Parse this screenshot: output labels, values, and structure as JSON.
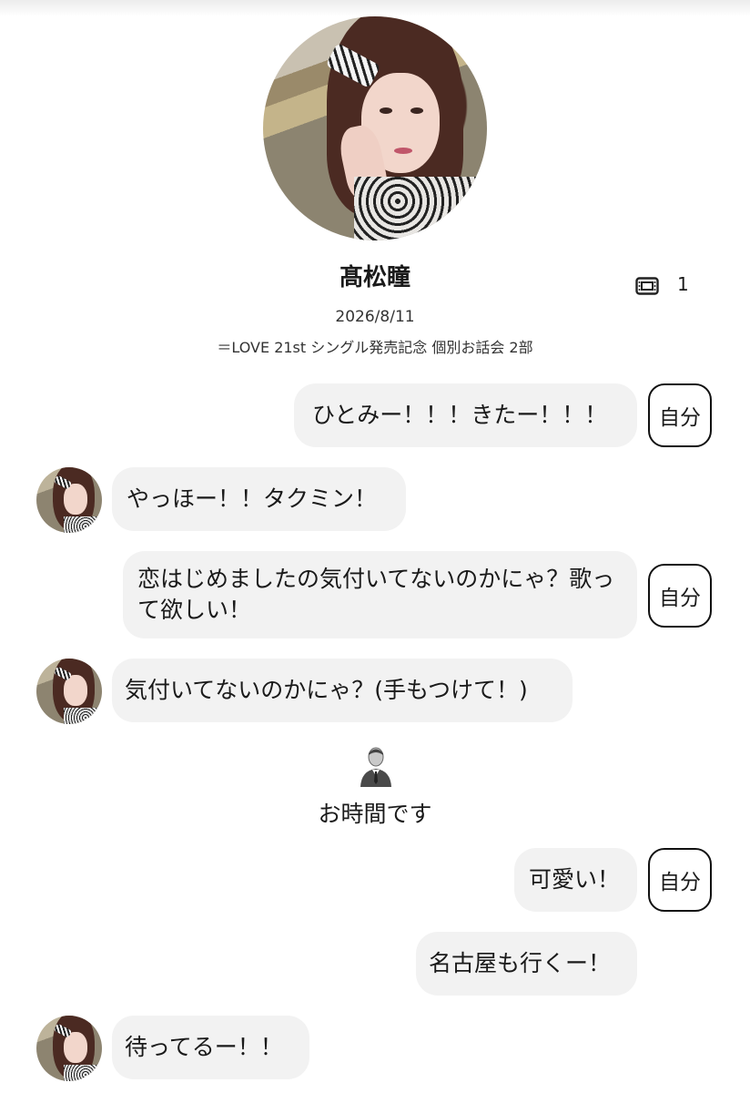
{
  "profile": {
    "name": "髙松瞳",
    "ticket_count": "1",
    "date": "2026/8/11",
    "event": "＝LOVE 21st シングル発売記念 個別お話会 2部"
  },
  "messages": [
    {
      "sender": "self",
      "text": "ひとみー！！！きたー！！！",
      "tag": "自分"
    },
    {
      "sender": "idol",
      "text": "やっほー！！タクミン！"
    },
    {
      "sender": "self",
      "text": "恋はじめましたの気付いてないのかにゃ？歌って欲しい！",
      "tag": "自分"
    },
    {
      "sender": "idol",
      "text": "気付いてないのかにゃ？(手もつけて！)"
    },
    {
      "sender": "system",
      "text": "お時間です",
      "icon": "staff-person-icon"
    },
    {
      "sender": "self",
      "text": "可愛い！",
      "tag": "自分"
    },
    {
      "sender": "self",
      "text": "名古屋も行くー！"
    },
    {
      "sender": "idol",
      "text": "待ってるー！！"
    }
  ]
}
